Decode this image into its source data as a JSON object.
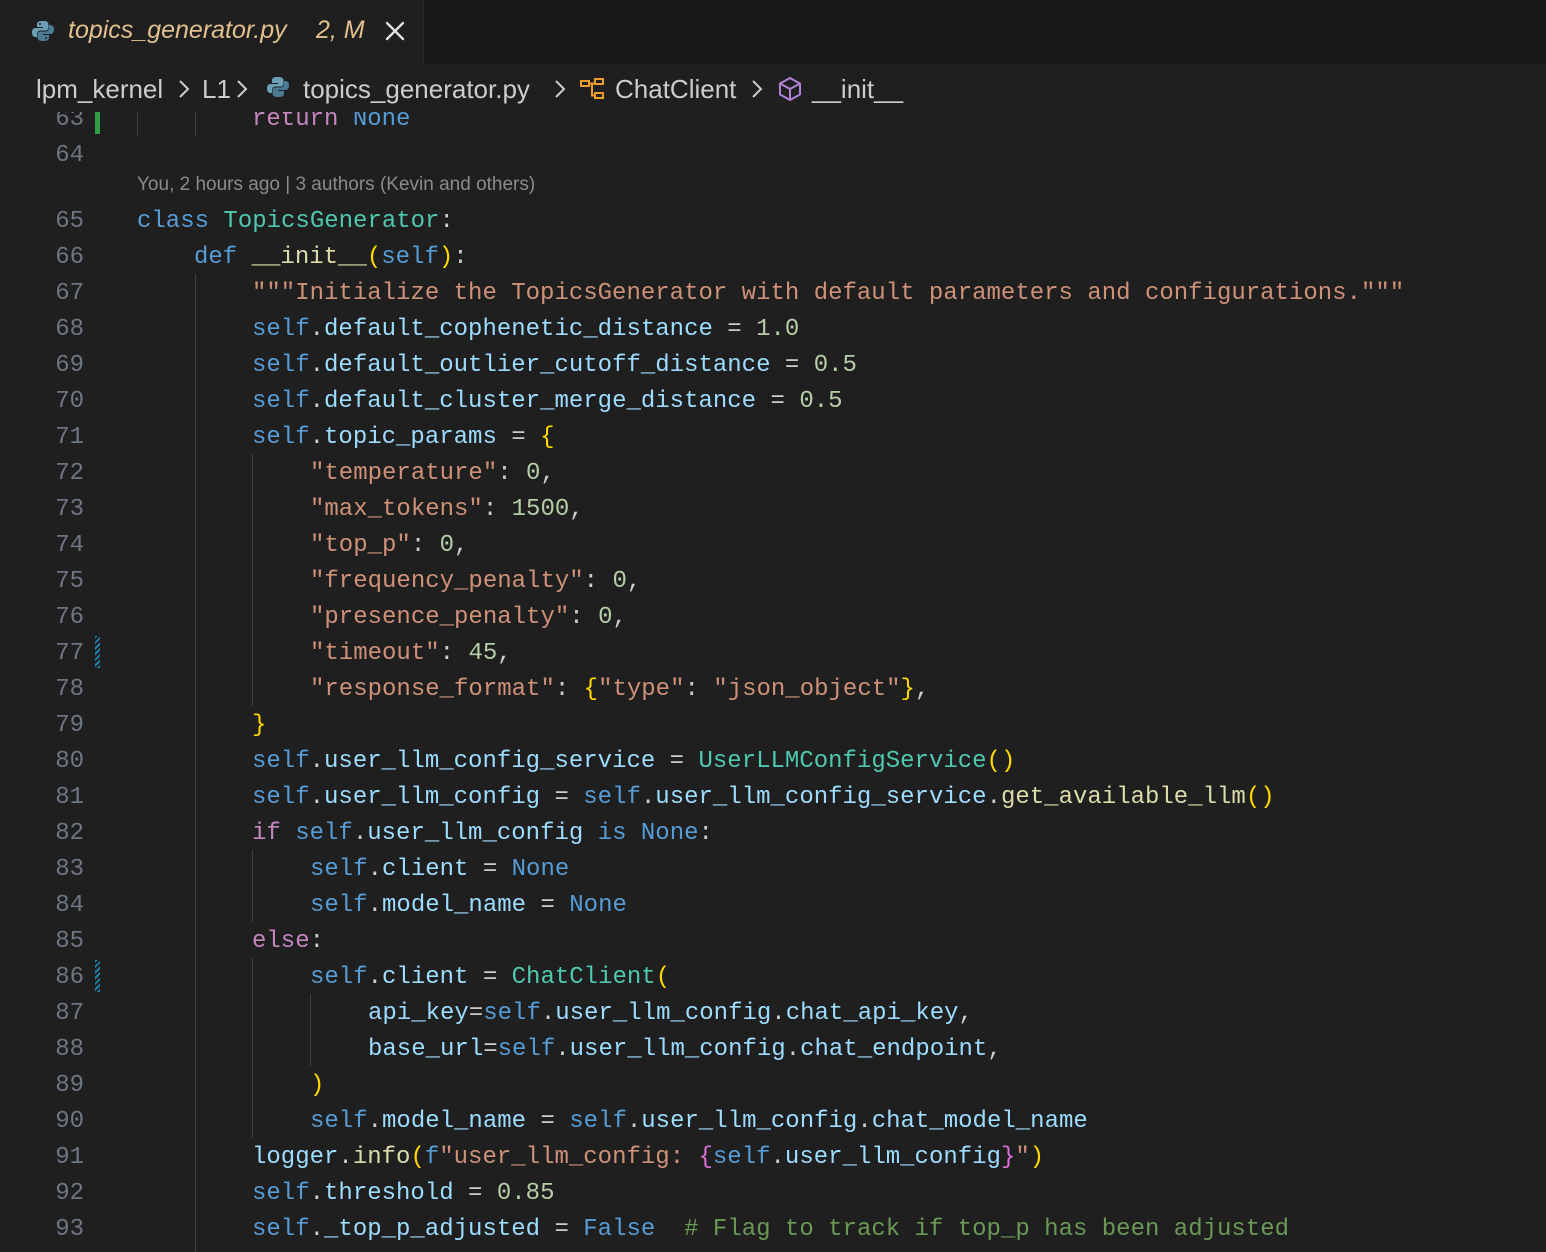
{
  "tab": {
    "filename": "topics_generator.py",
    "status": "2, M",
    "icon": "python-file-icon",
    "close_icon": "close-icon"
  },
  "breadcrumb": [
    {
      "label": "lpm_kernel",
      "icon": ""
    },
    {
      "label": "L1",
      "icon": ""
    },
    {
      "label": "topics_generator.py",
      "icon": "python-file-icon"
    },
    {
      "label": "ChatClient",
      "icon": "class-symbol-icon"
    },
    {
      "label": "__init__",
      "icon": "method-symbol-icon"
    }
  ],
  "blame": "You, 2 hours ago | 3 authors (Kevin and others)",
  "line_numbers": [
    "63",
    "64",
    "65",
    "66",
    "67",
    "68",
    "69",
    "70",
    "71",
    "72",
    "73",
    "74",
    "75",
    "76",
    "77",
    "78",
    "79",
    "80",
    "81",
    "82",
    "83",
    "84",
    "85",
    "86",
    "87",
    "88",
    "89",
    "90",
    "91",
    "92",
    "93"
  ],
  "code_text": {
    "l63": "return None",
    "l65": "class TopicsGenerator:",
    "l66": "def __init__(self):",
    "l67": "\"\"\"Initialize the TopicsGenerator with default parameters and configurations.\"\"\"",
    "l68": "self.default_cophenetic_distance = 1.0",
    "l69": "self.default_outlier_cutoff_distance = 0.5",
    "l70": "self.default_cluster_merge_distance = 0.5",
    "l71": "self.topic_params = {",
    "l72": "\"temperature\": 0,",
    "l73": "\"max_tokens\": 1500,",
    "l74": "\"top_p\": 0,",
    "l75": "\"frequency_penalty\": 0,",
    "l76": "\"presence_penalty\": 0,",
    "l77": "\"timeout\": 45,",
    "l78": "\"response_format\": {\"type\": \"json_object\"},",
    "l79": "}",
    "l80": "self.user_llm_config_service = UserLLMConfigService()",
    "l81": "self.user_llm_config = self.user_llm_config_service.get_available_llm()",
    "l82": "if self.user_llm_config is None:",
    "l83": "self.client = None",
    "l84": "self.model_name = None",
    "l85": "else:",
    "l86": "self.client = ChatClient(",
    "l87": "api_key=self.user_llm_config.chat_api_key,",
    "l88": "base_url=self.user_llm_config.chat_endpoint,",
    "l89": ")",
    "l90": "self.model_name = self.user_llm_config.chat_model_name",
    "l91": "logger.info(f\"user_llm_config: {self.user_llm_config}\")",
    "l92": "self.threshold = 0.85",
    "l93": "self._top_p_adjusted = False  # Flag to track if top_p has been adjusted"
  },
  "gutter_markers": [
    {
      "line": "63",
      "type": "added"
    },
    {
      "line": "77",
      "type": "modified"
    },
    {
      "line": "86",
      "type": "modified"
    }
  ],
  "colors": {
    "background": "#1f1f1f",
    "keyword": "#569cd6",
    "control_keyword": "#c586c0",
    "class_name": "#4ec9b0",
    "function": "#dcdcaa",
    "variable": "#9cdcfe",
    "string": "#ce9178",
    "number": "#b5cea8",
    "comment": "#6a9955",
    "modified_tab": "#e2c08d"
  }
}
